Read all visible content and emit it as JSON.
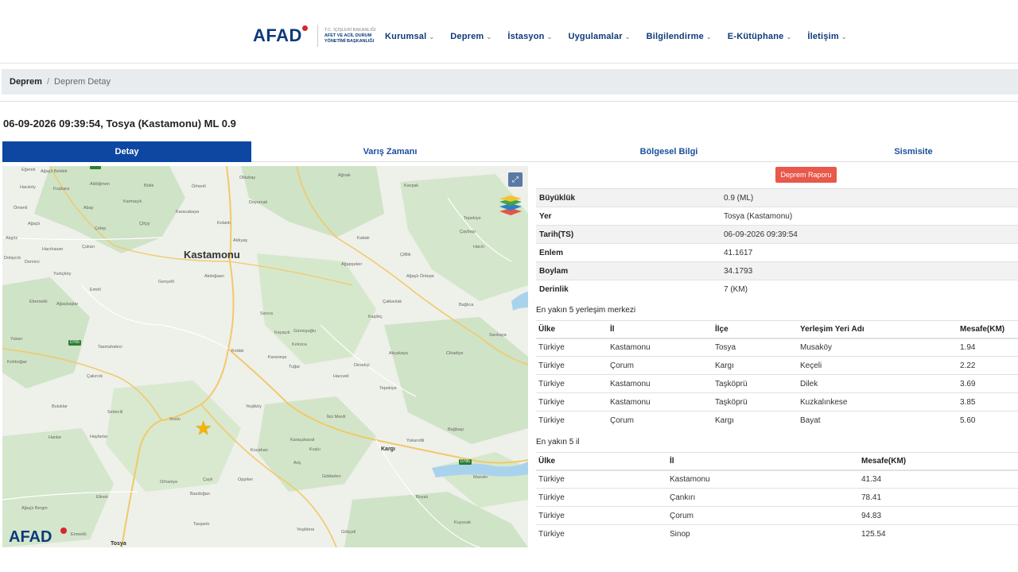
{
  "header": {
    "logo_text": "AFAD",
    "logo_sub_top": "T.C. İÇİŞLERİ BAKANLIĞI",
    "logo_sub_1": "AFET VE ACİL DURUM",
    "logo_sub_2": "YÖNETİMİ BAŞKANLIĞI",
    "nav": [
      {
        "label": "Kurumsal"
      },
      {
        "label": "Deprem"
      },
      {
        "label": "İstasyon"
      },
      {
        "label": "Uygulamalar"
      },
      {
        "label": "Bilgilendirme"
      },
      {
        "label": "E-Kütüphane"
      },
      {
        "label": "İletişim"
      }
    ]
  },
  "breadcrumb": {
    "first": "Deprem",
    "separator": "/",
    "second": "Deprem Detay"
  },
  "title": "06-09-2026 09:39:54, Tosya (Kastamonu) ML 0.9",
  "tabs": [
    {
      "label": "Detay",
      "active": true
    },
    {
      "label": "Varış Zamanı",
      "active": false
    },
    {
      "label": "Bölgesel Bilgi",
      "active": false
    },
    {
      "label": "Sismisite",
      "active": false
    }
  ],
  "map": {
    "city": "Kastamonu",
    "logo_text": "AFAD",
    "bottom_town": "Tosya",
    "kargi": "Kargı",
    "road_badges": [
      "D765",
      "D785"
    ],
    "labels": [
      {
        "t": "Eğerek"
      },
      {
        "t": "Ağaçlı Beldek"
      },
      {
        "t": "Aldöğmen"
      },
      {
        "t": "Bükk"
      },
      {
        "t": "Örhenli"
      },
      {
        "t": "Hacıköy"
      },
      {
        "t": "Kuşkara"
      },
      {
        "t": "Karmaçık"
      },
      {
        "t": "Karacakaya"
      },
      {
        "t": "Ömenli"
      },
      {
        "t": "Abay"
      },
      {
        "t": "Ağaçlı"
      },
      {
        "t": "Çelep"
      },
      {
        "t": "Çifçiy"
      },
      {
        "t": "Kolanlı"
      },
      {
        "t": "Aldıyaş"
      },
      {
        "t": "Hacıhasan"
      },
      {
        "t": "Akgöz"
      },
      {
        "t": "Demirci"
      },
      {
        "t": "Yurkçköy"
      },
      {
        "t": "Çukarı"
      },
      {
        "t": "Emirli"
      },
      {
        "t": "Gençelli"
      },
      {
        "t": "Akdoğaan"
      },
      {
        "t": "Ebersekli"
      },
      {
        "t": "Ağaçkaşlar"
      },
      {
        "t": "Tasmahaleci"
      },
      {
        "t": "Yukarı"
      },
      {
        "t": "Çakırcık"
      },
      {
        "t": "Buluklar"
      },
      {
        "t": "Kırkboğaz"
      },
      {
        "t": "Sebecili"
      },
      {
        "t": "Hayfarlar"
      },
      {
        "t": "Hanlar"
      },
      {
        "t": "Elinek"
      },
      {
        "t": "Ağaçlı Bergin"
      },
      {
        "t": "Enmekli"
      },
      {
        "t": "Soslu"
      },
      {
        "t": "Bazdoğan"
      },
      {
        "t": "Karaçukaval"
      },
      {
        "t": "Çaylı"
      },
      {
        "t": "Oppiker"
      },
      {
        "t": "Ariç"
      },
      {
        "t": "Gökbelen"
      },
      {
        "t": "Kuşlu"
      },
      {
        "t": "Tavşanlı"
      },
      {
        "t": "Hacıveli"
      },
      {
        "t": "Mandırı"
      },
      {
        "t": "Yeşilköy"
      },
      {
        "t": "Tuğar"
      },
      {
        "t": "Kodalı"
      },
      {
        "t": "Karaneşe"
      },
      {
        "t": "İkiz Merdi"
      },
      {
        "t": "Bağbaşı"
      },
      {
        "t": "Yukarıdili"
      },
      {
        "t": "Akçakaya"
      },
      {
        "t": "Cihadiye"
      },
      {
        "t": "Tepekiye"
      },
      {
        "t": "Ağnak"
      },
      {
        "t": "Kavşak"
      },
      {
        "t": "Doyurcak"
      },
      {
        "t": "Kabalı"
      },
      {
        "t": "Gümüşoğlu"
      },
      {
        "t": "Ağapşeker"
      },
      {
        "t": "Ağaçlı Öntepe"
      },
      {
        "t": "Çatkavlak"
      },
      {
        "t": "Kaşlıkç"
      },
      {
        "t": "Sarıca"
      },
      {
        "t": "Çaybaşı"
      },
      {
        "t": "Tepekiye"
      },
      {
        "t": "Çiftlik"
      },
      {
        "t": "Kayaçık"
      },
      {
        "t": "Kırkoca"
      },
      {
        "t": "Dirsekçi"
      },
      {
        "t": "Oklubay"
      },
      {
        "t": "Dolaycık"
      },
      {
        "t": "Hacılı"
      },
      {
        "t": "Sarıkaya"
      },
      {
        "t": "Bağlıca"
      },
      {
        "t": "Kocahan"
      },
      {
        "t": "Orhaniye"
      },
      {
        "t": "Boyalı"
      },
      {
        "t": "Gökçeli"
      },
      {
        "t": "Kuyucak"
      },
      {
        "t": "Yeşildere"
      }
    ]
  },
  "report_button": "Deprem Raporu",
  "details": [
    {
      "key": "Büyüklük",
      "value": "0.9 (ML)"
    },
    {
      "key": "Yer",
      "value": "Tosya (Kastamonu)"
    },
    {
      "key": "Tarih(TS)",
      "value": "06-09-2026 09:39:54"
    },
    {
      "key": "Enlem",
      "value": "41.1617"
    },
    {
      "key": "Boylam",
      "value": "34.1793"
    },
    {
      "key": "Derinlik",
      "value": "7 (KM)"
    }
  ],
  "nearest_settlements": {
    "title": "En yakın 5 yerleşim merkezi",
    "headers": [
      "Ülke",
      "İl",
      "İlçe",
      "Yerleşim Yeri Adı",
      "Mesafe(KM)"
    ],
    "rows": [
      [
        "Türkiye",
        "Kastamonu",
        "Tosya",
        "Musaköy",
        "1.94"
      ],
      [
        "Türkiye",
        "Çorum",
        "Kargı",
        "Keçeli",
        "2.22"
      ],
      [
        "Türkiye",
        "Kastamonu",
        "Taşköprü",
        "Dilek",
        "3.69"
      ],
      [
        "Türkiye",
        "Kastamonu",
        "Taşköprü",
        "Kuzkalınkese",
        "3.85"
      ],
      [
        "Türkiye",
        "Çorum",
        "Kargı",
        "Bayat",
        "5.60"
      ]
    ]
  },
  "nearest_provinces": {
    "title": "En yakın 5 il",
    "headers": [
      "Ülke",
      "İl",
      "Mesafe(KM)"
    ],
    "rows": [
      [
        "Türkiye",
        "Kastamonu",
        "41.34"
      ],
      [
        "Türkiye",
        "Çankırı",
        "78.41"
      ],
      [
        "Türkiye",
        "Çorum",
        "94.83"
      ],
      [
        "Türkiye",
        "Sinop",
        "125.54"
      ]
    ]
  },
  "colors": {
    "primary": "#0d47a1",
    "report": "#e8584b",
    "star": "#f5b400"
  }
}
